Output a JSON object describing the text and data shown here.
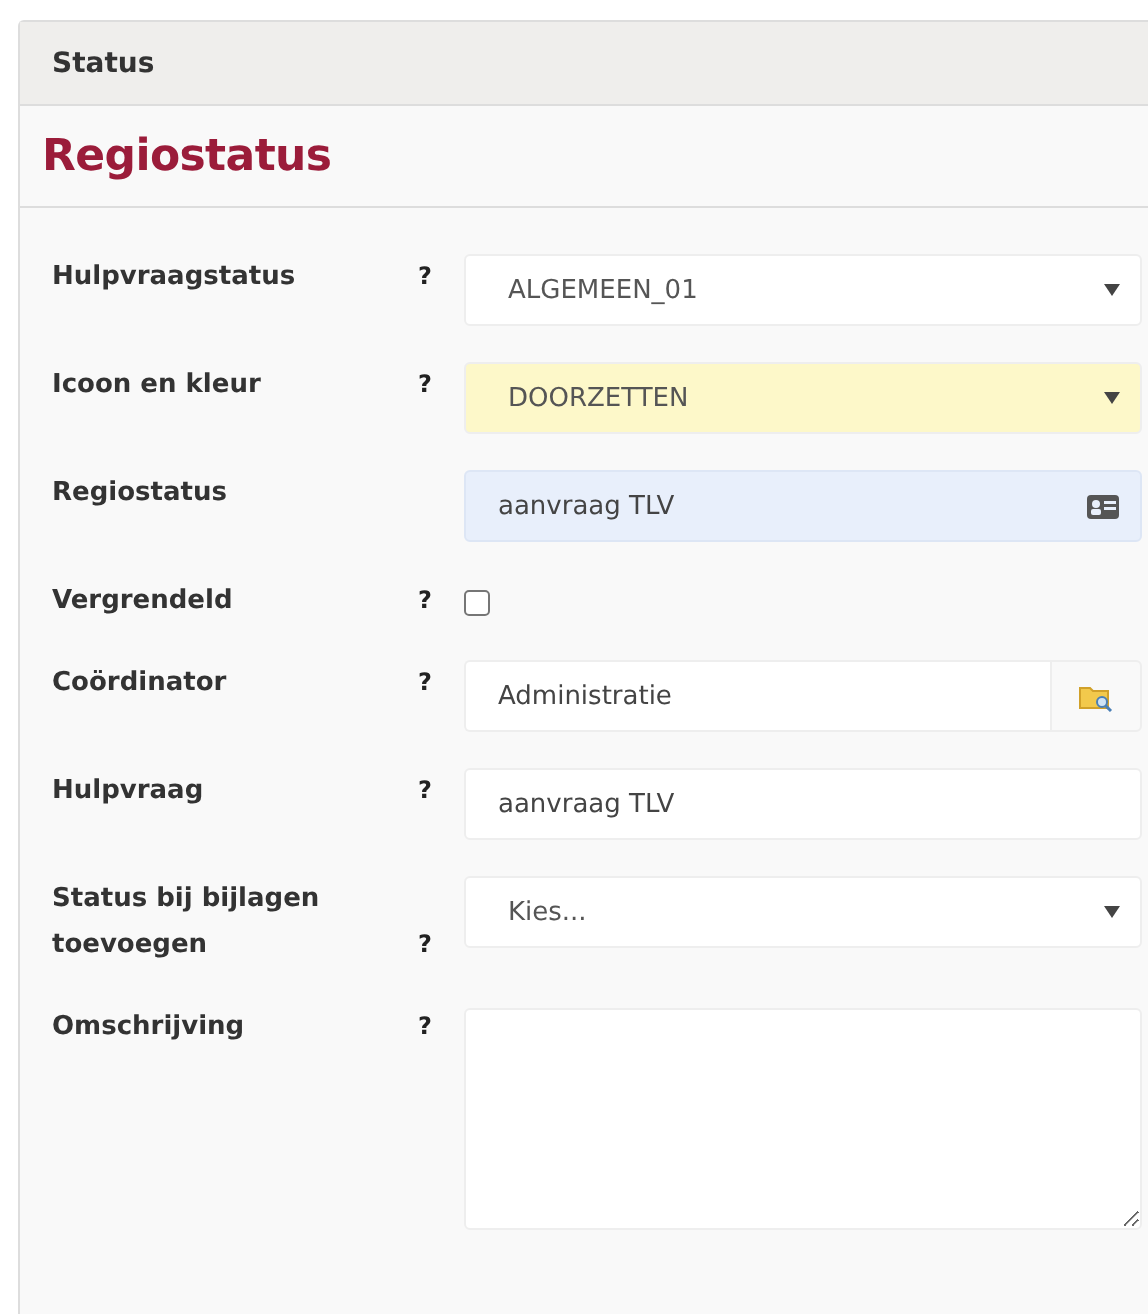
{
  "panel": {
    "title": "Status"
  },
  "section": {
    "title": "Regiostatus"
  },
  "fields": [
    {
      "label": "Hulpvraagstatus",
      "help": "?",
      "kind": "select",
      "value": "ALGEMEEN_01"
    },
    {
      "label": "Icoon en kleur",
      "help": "?",
      "kind": "select",
      "value": "DOORZETTEN",
      "color": "#fdf8c9"
    },
    {
      "label": "Regiostatus",
      "kind": "readonly",
      "value": "aanvraag TLV",
      "color": "#e8effb"
    },
    {
      "label": "Vergrendeld",
      "help": "?",
      "kind": "checkbox",
      "checked": false
    },
    {
      "label": "Coördinator",
      "help": "?",
      "kind": "lookup",
      "value": "Administratie"
    },
    {
      "label": "Hulpvraag",
      "help": "?",
      "kind": "text",
      "value": "aanvraag TLV"
    },
    {
      "label": "Status bij bijlagen toevoegen",
      "help": "?",
      "kind": "select",
      "value": "Kies..."
    },
    {
      "label": "Omschrijving",
      "help": "?",
      "kind": "textarea"
    }
  ]
}
